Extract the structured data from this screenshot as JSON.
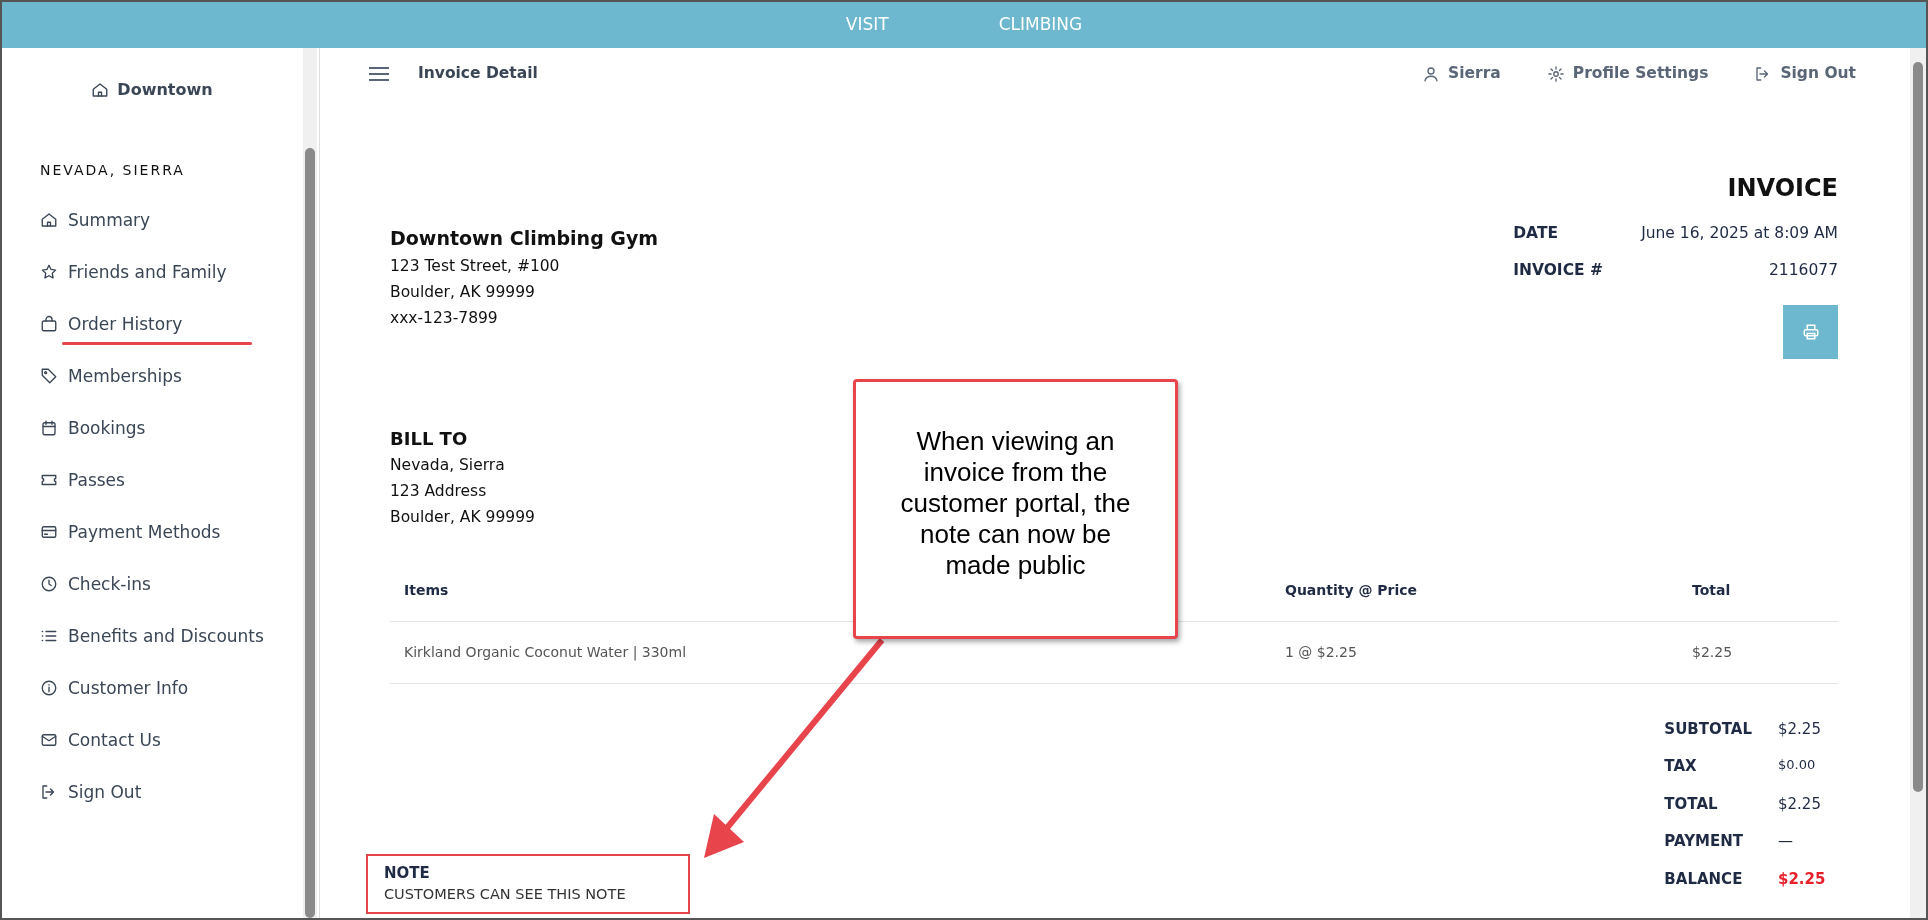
{
  "top_bar": {
    "links": [
      "VISIT",
      "CLIMBING"
    ]
  },
  "sidebar": {
    "location": "Downtown",
    "customer_name": "NEVADA, SIERRA",
    "items": [
      {
        "label": "Summary",
        "underlined": false
      },
      {
        "label": "Friends and Family",
        "underlined": false
      },
      {
        "label": "Order History",
        "underlined": true
      },
      {
        "label": "Memberships",
        "underlined": false
      },
      {
        "label": "Bookings",
        "underlined": false
      },
      {
        "label": "Passes",
        "underlined": false
      },
      {
        "label": "Payment Methods",
        "underlined": false
      },
      {
        "label": "Check-ins",
        "underlined": false
      },
      {
        "label": "Benefits and Discounts",
        "underlined": false
      },
      {
        "label": "Customer Info",
        "underlined": false
      },
      {
        "label": "Contact Us",
        "underlined": false
      },
      {
        "label": "Sign Out",
        "underlined": false
      }
    ]
  },
  "header": {
    "title": "Invoice Detail",
    "user": "Sierra",
    "profile_settings": "Profile Settings",
    "sign_out": "Sign Out"
  },
  "invoice": {
    "heading": "INVOICE",
    "company": {
      "name": "Downtown Climbing Gym",
      "lines": [
        "123 Test Street, #100",
        "Boulder, AK 99999",
        "xxx-123-7899"
      ]
    },
    "meta": [
      {
        "label": "DATE",
        "value": "June 16, 2025 at 8:09 AM"
      },
      {
        "label": "INVOICE #",
        "value": "2116077"
      }
    ],
    "bill_to": {
      "heading": "BILL TO",
      "lines": [
        "Nevada, Sierra",
        "123 Address",
        "Boulder, AK 99999"
      ]
    },
    "table": {
      "columns": [
        "Items",
        "Quantity @ Price",
        "Total"
      ],
      "rows": [
        [
          "Kirkland Organic Coconut Water | 330ml",
          "1 @ $2.25",
          "$2.25"
        ]
      ]
    },
    "totals": [
      {
        "label": "SUBTOTAL",
        "value": "$2.25",
        "kind": "amount"
      },
      {
        "label": "TAX",
        "value": "$0.00",
        "kind": "small"
      },
      {
        "label": "TOTAL",
        "value": "$2.25",
        "kind": "amount"
      },
      {
        "label": "PAYMENT",
        "value": "—",
        "kind": "empty"
      },
      {
        "label": "BALANCE",
        "value": "$2.25",
        "kind": "balance"
      }
    ],
    "note": {
      "heading": "NOTE",
      "text": "CUSTOMERS CAN SEE THIS NOTE",
      "highlighted": true
    }
  },
  "annotations": [
    {
      "text": "When viewing an invoice from the customer portal, the note can now be made public"
    }
  ]
}
